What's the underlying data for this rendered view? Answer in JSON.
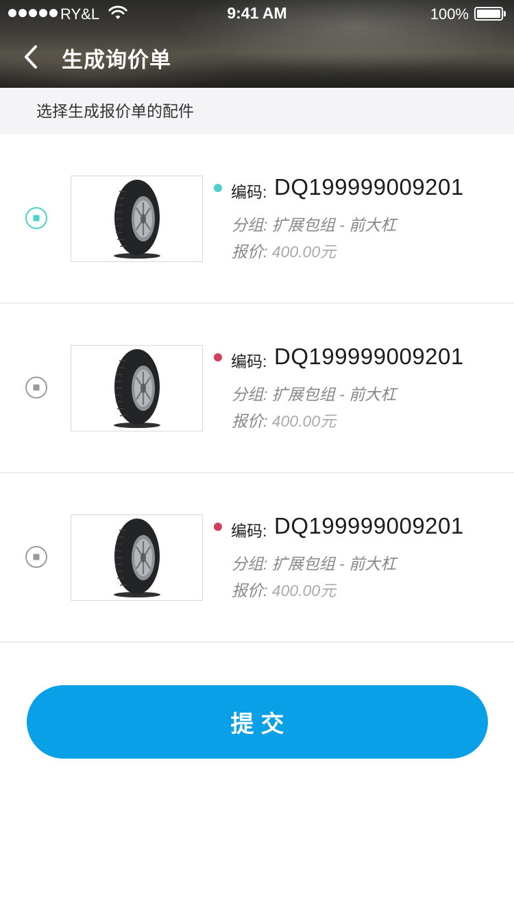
{
  "status_bar": {
    "carrier": "RY&L",
    "time": "9:41 AM",
    "battery": "100%",
    "icons": [
      "signal-dots-icon",
      "wifi-icon",
      "battery-icon"
    ]
  },
  "nav": {
    "back_icon": "chevron-left-icon",
    "title": "生成询价单"
  },
  "hint": "选择生成报价单的配件",
  "items": [
    {
      "selected": true,
      "status_color": "#4fd1c5",
      "image_icon": "tire-image",
      "code_label": "编码:",
      "code": "DQ199999009201",
      "group_label": "分组:",
      "group": "扩展包组 - 前大杠",
      "price_label": "报价:",
      "price": "400.00元"
    },
    {
      "selected": false,
      "status_color": "#d0405a",
      "image_icon": "tire-image",
      "code_label": "编码:",
      "code": "DQ199999009201",
      "group_label": "分组:",
      "group": "扩展包组 - 前大杠",
      "price_label": "报价:",
      "price": "400.00元"
    },
    {
      "selected": false,
      "status_color": "#d0405a",
      "image_icon": "tire-image",
      "code_label": "编码:",
      "code": "DQ199999009201",
      "group_label": "分组:",
      "group": "扩展包组 - 前大杠",
      "price_label": "报价:",
      "price": "400.00元"
    }
  ],
  "submit_label": "提交",
  "colors": {
    "accent": "#0aa0e8",
    "selected": "#4fd1c5",
    "unselected": "#9a9a9a",
    "alert": "#d0405a"
  }
}
